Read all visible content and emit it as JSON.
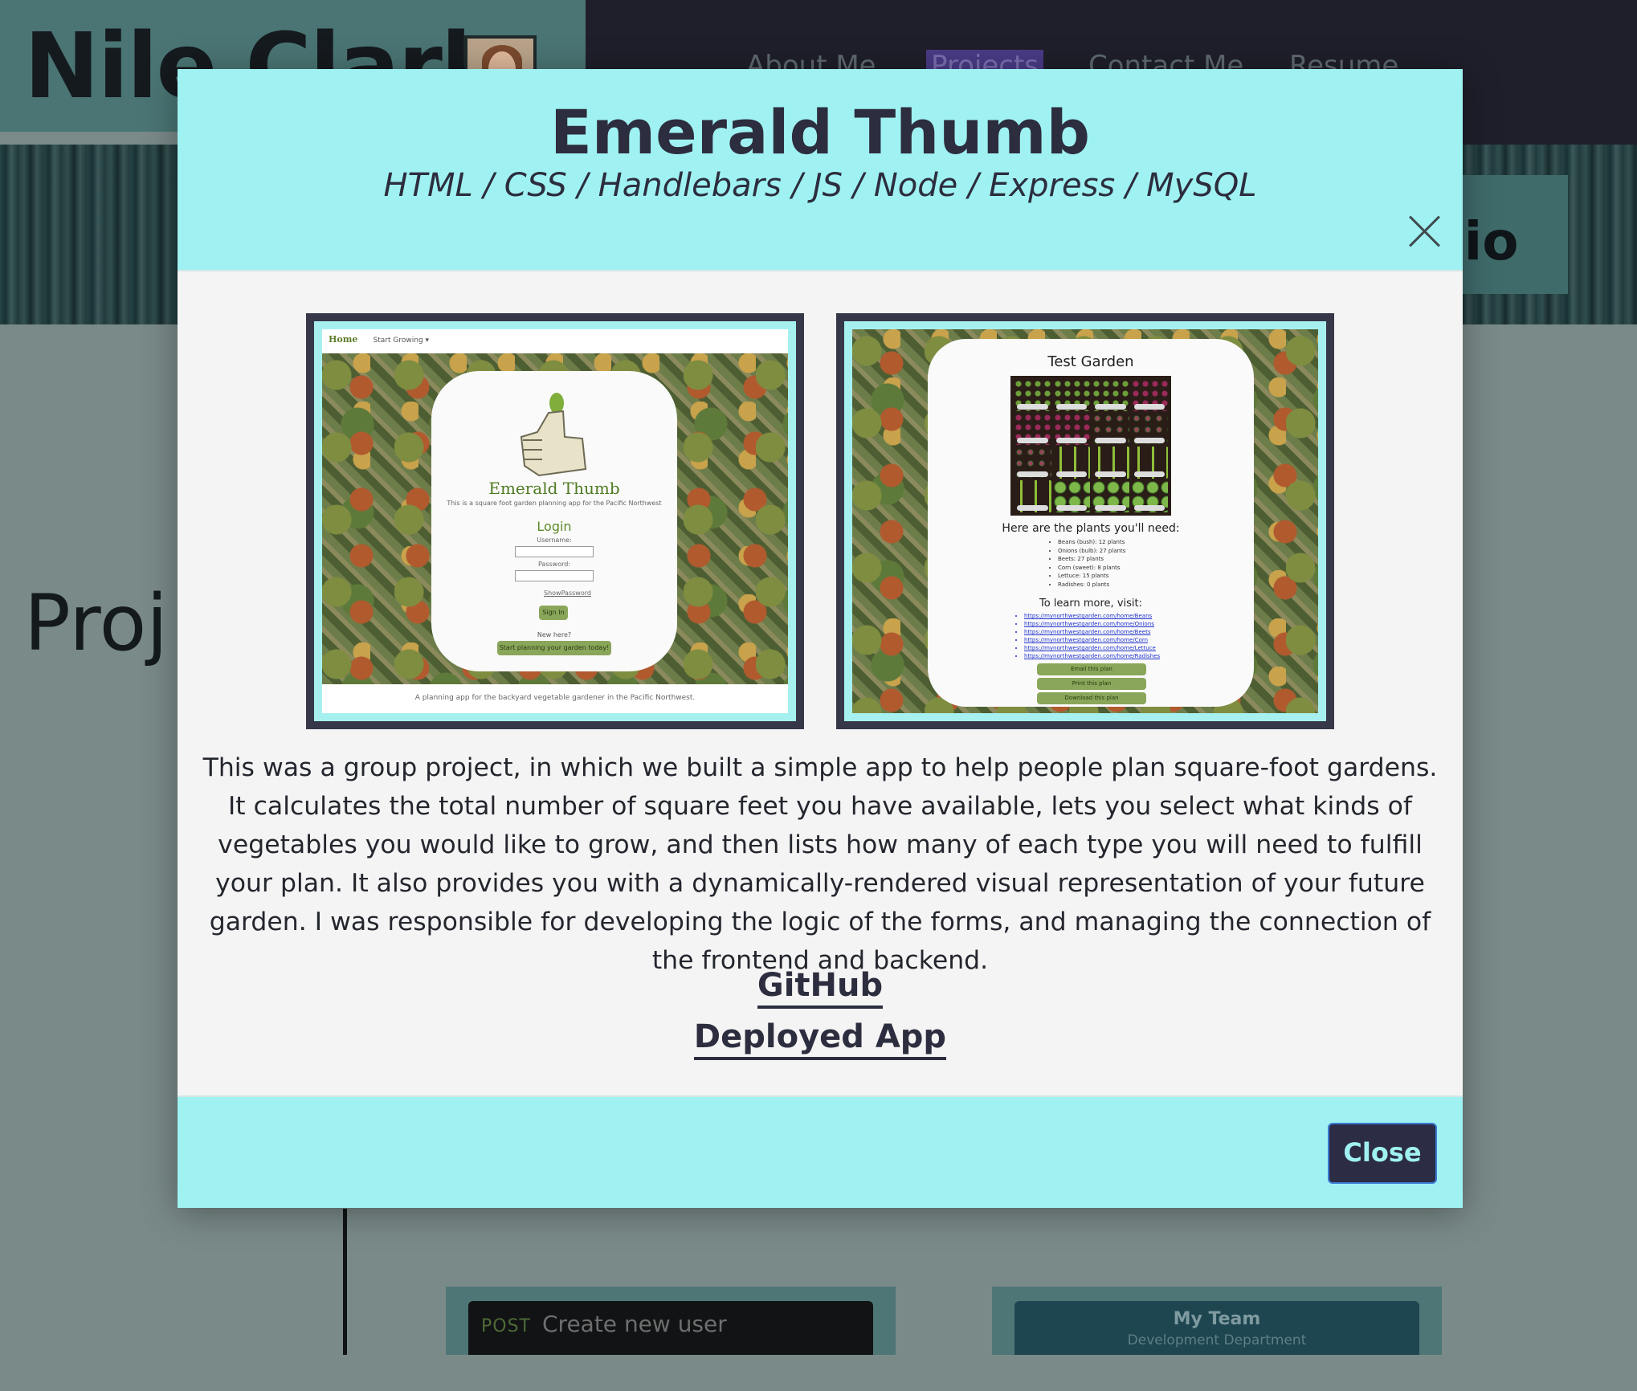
{
  "background": {
    "brand": "Nile Clark",
    "nav": [
      {
        "label": "About Me",
        "active": false
      },
      {
        "label": "Projects",
        "active": true
      },
      {
        "label": "Contact Me",
        "active": false
      },
      {
        "label": "Resume",
        "active": false
      }
    ],
    "portfolio_fragment": "lio",
    "section_heading_fragment": "Proj",
    "card_left": {
      "method": "POST",
      "text": "Create new user"
    },
    "card_right": {
      "title": "My Team",
      "subtitle": "Development Department"
    }
  },
  "modal": {
    "title": "Emerald Thumb",
    "subtitle": "HTML / CSS / Handlebars / JS / Node / Express / MySQL",
    "screenshot_1": {
      "nav_home": "Home",
      "nav_menu": "Start Growing ▾",
      "brand": "Emerald Thumb",
      "tagline": "This is a square foot garden planning app for the Pacific Northwest",
      "login_heading": "Login",
      "username_label": "Username:",
      "password_label": "Password:",
      "show_password": "ShowPassword",
      "sign_in": "Sign In",
      "new_here": "New here?",
      "cta": "Start planning your garden today!",
      "footer": "A planning app for the backyard vegetable gardener in the Pacific Northwest."
    },
    "screenshot_2": {
      "title": "Test Garden",
      "plants_heading": "Here are the plants you'll need:",
      "plants": [
        "Beans (bush): 12 plants",
        "Onions (bulb): 27 plants",
        "Beets: 27 plants",
        "Corn (sweet): 8 plants",
        "Lettuce: 15 plants",
        "Radishes: 0 plants"
      ],
      "learn_heading": "To learn more, visit:",
      "links": [
        "https://mynorthwestgarden.com/home/Beans",
        "https://mynorthwestgarden.com/home/Onions",
        "https://mynorthwestgarden.com/home/Beets",
        "https://mynorthwestgarden.com/home/Corn",
        "https://mynorthwestgarden.com/home/Lettuce",
        "https://mynorthwestgarden.com/home/Radishes"
      ],
      "buttons": [
        "Email this plan",
        "Print this plan",
        "Download this plan"
      ]
    },
    "description": "This was a group project, in which we built a simple app to help people plan square-foot gardens. It calculates the total number of square feet you have available, lets you select what kinds of vegetables you would like to grow, and then lists how many of each type you will need to fulfill your plan. It also provides you with a dynamically-rendered visual representation of your future garden. I was responsible for developing the logic of the forms, and managing the connection of the frontend and backend.",
    "links": {
      "github": "GitHub",
      "deployed": "Deployed App"
    },
    "close_button": "Close"
  },
  "colors": {
    "modal_header": "#a0f2f2",
    "modal_body": "#f4f4f4",
    "dark_text": "#2c2d3e",
    "close_button_bg": "#2c2d44"
  }
}
